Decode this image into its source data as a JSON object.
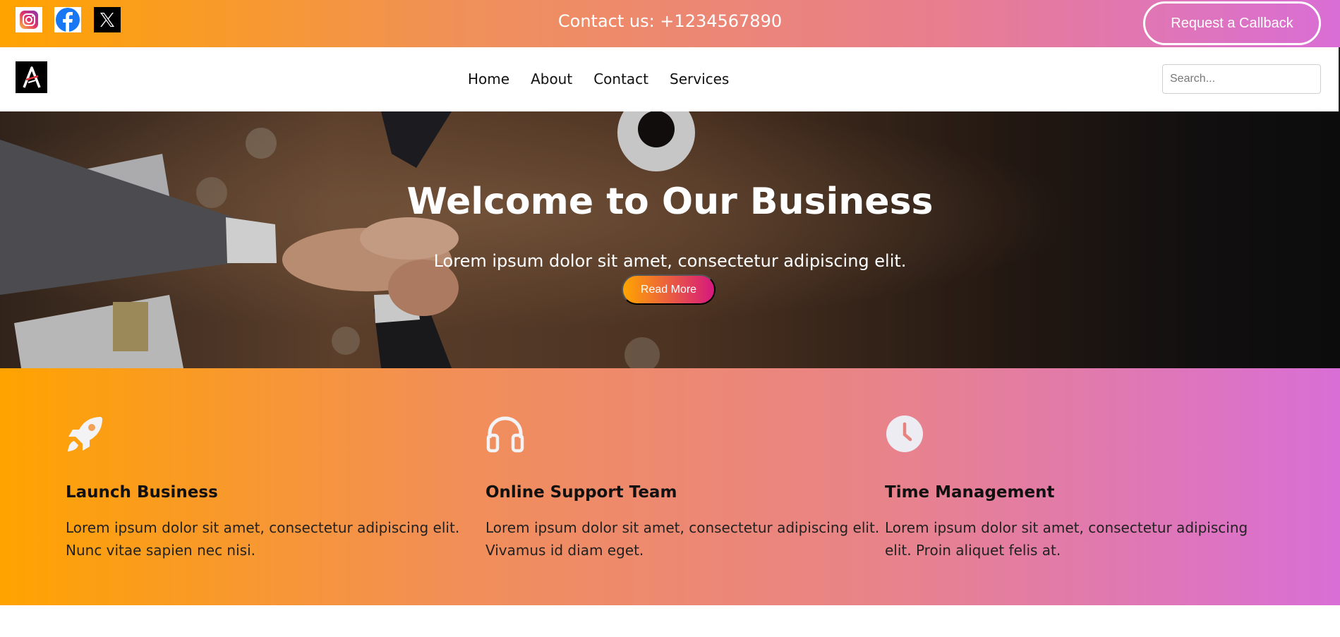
{
  "topbar": {
    "social": [
      {
        "name": "instagram-icon"
      },
      {
        "name": "facebook-icon"
      },
      {
        "name": "x-icon"
      }
    ],
    "contact": "Contact us: +1234567890",
    "callback_label": "Request a Callback"
  },
  "navbar": {
    "links": [
      "Home",
      "About",
      "Contact",
      "Services"
    ],
    "search_placeholder": "Search..."
  },
  "hero": {
    "title": "Welcome to Our Business",
    "subtitle": "Lorem ipsum dolor sit amet, consectetur adipiscing elit.",
    "button_label": "Read More"
  },
  "features": [
    {
      "icon": "rocket-icon",
      "title": "Launch Business",
      "description": "Lorem ipsum dolor sit amet, consectetur adipiscing elit. Nunc vitae sapien nec nisi."
    },
    {
      "icon": "headphones-icon",
      "title": "Online Support Team",
      "description": "Lorem ipsum dolor sit amet, consectetur adipiscing elit. Vivamus id diam eget."
    },
    {
      "icon": "clock-icon",
      "title": "Time Management",
      "description": "Lorem ipsum dolor sit amet, consectetur adipiscing elit. Proin aliquet felis at."
    }
  ],
  "colors": {
    "gradient_start": "#ffa300",
    "gradient_end": "#d96ed6",
    "button_gradient_start": "#ffa500",
    "button_gradient_end": "#d6187e"
  }
}
